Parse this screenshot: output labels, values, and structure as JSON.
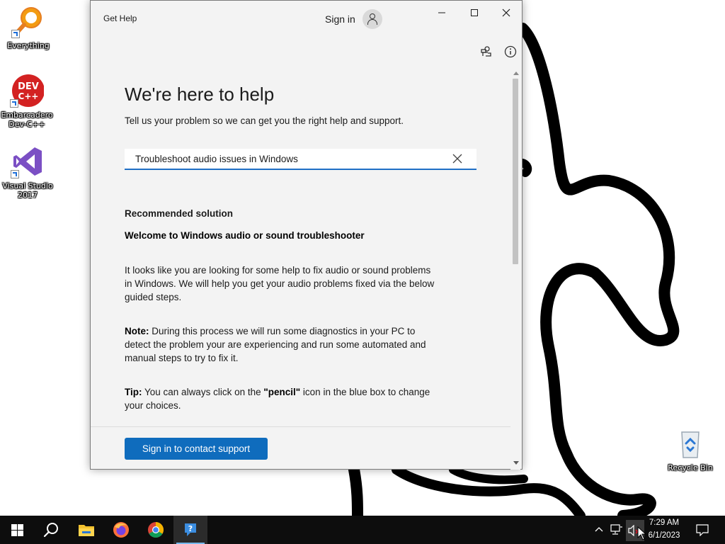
{
  "desktop": {
    "icons": [
      {
        "label": "Everything",
        "icon": "everything-magnifier-icon"
      },
      {
        "label": "Embarcadero\nDev-C++",
        "icon": "devcpp-icon",
        "badge": "DEV\nC++"
      },
      {
        "label": "Visual Studio\n2017",
        "icon": "visual-studio-icon"
      },
      {
        "label": "Recycle Bin",
        "icon": "recycle-bin-icon"
      }
    ]
  },
  "window": {
    "app_title": "Get Help",
    "sign_in_label": "Sign in",
    "heading": "We're here to help",
    "subheading": "Tell us your problem so we can get you the right help and support.",
    "search": {
      "value": "Troubleshoot audio issues in Windows"
    },
    "recommended_label": "Recommended solution",
    "solution_title": "Welcome to Windows audio or sound troubleshooter",
    "paragraph1": "It looks like you are looking for some help to fix audio or sound problems in Windows. We will help you get your audio problems fixed via the below guided steps.",
    "note_label": "Note:",
    "note_text": " During this process we will run some diagnostics in your PC to detect the problem your are experiencing and run some automated  and manual steps to try to fix it.",
    "tip_label": "Tip:",
    "tip_text_1": " You can always click on the ",
    "tip_bold": "\"pencil\"",
    "tip_text_2": " icon in the blue box to change your choices.",
    "contact_button": "Sign in to contact support"
  },
  "taskbar": {
    "time": "7:29 AM",
    "date": "6/1/2023",
    "apps": [
      "start-icon",
      "search-icon",
      "file-explorer-icon",
      "firefox-icon",
      "chrome-icon",
      "get-help-icon"
    ]
  },
  "colors": {
    "accent": "#0f6cbd",
    "search_underline": "#1f6fc5",
    "taskbar": "#0d0d0d"
  }
}
